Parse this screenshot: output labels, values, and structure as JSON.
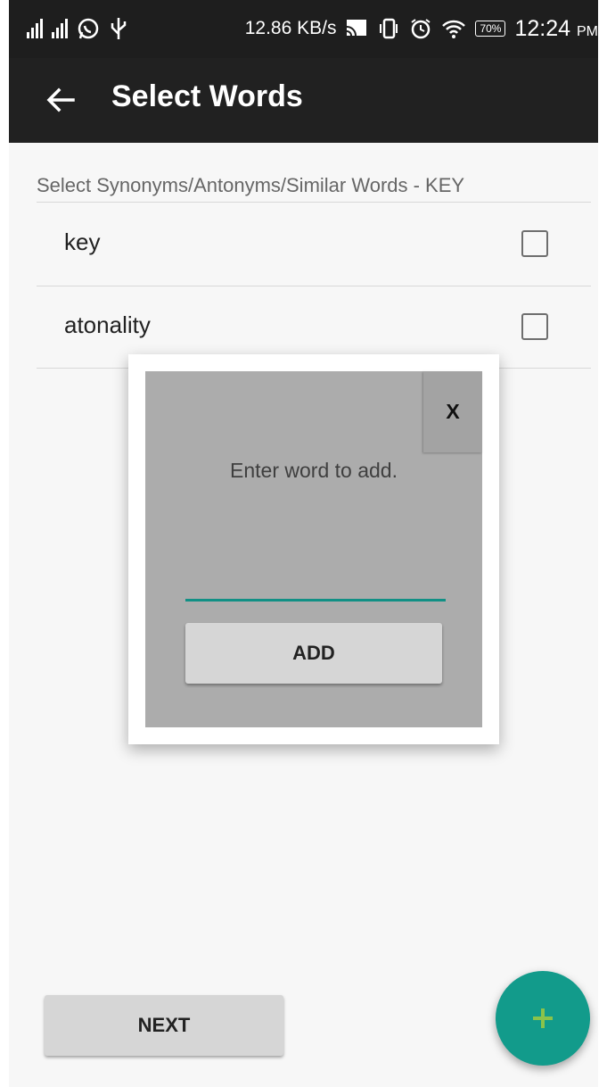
{
  "status_bar": {
    "network_speed": "12.86 KB/s",
    "battery": "70%",
    "time": "12:24",
    "time_suffix": "PM",
    "icons": [
      "signal-1-icon",
      "signal-2-icon",
      "whatsapp-icon",
      "usb-icon",
      "cast-icon",
      "vibrate-icon",
      "alarm-icon",
      "wifi-icon",
      "battery-icon"
    ]
  },
  "app_bar": {
    "title": "Select Words",
    "back_icon": "arrow-back-icon"
  },
  "section": {
    "title": "Select Synonyms/Antonyms/Similar Words - KEY"
  },
  "words": [
    {
      "label": "key",
      "checked": false
    },
    {
      "label": "atonality",
      "checked": false
    }
  ],
  "dialog": {
    "close_label": "X",
    "prompt": "Enter word to add.",
    "input_value": "",
    "add_label": "ADD"
  },
  "bottom": {
    "next_label": "NEXT",
    "fab_icon": "plus-icon"
  },
  "colors": {
    "app_bar": "#212121",
    "accent": "#129b8b",
    "underline": "#119085",
    "fab_plus": "#8bc34a"
  }
}
